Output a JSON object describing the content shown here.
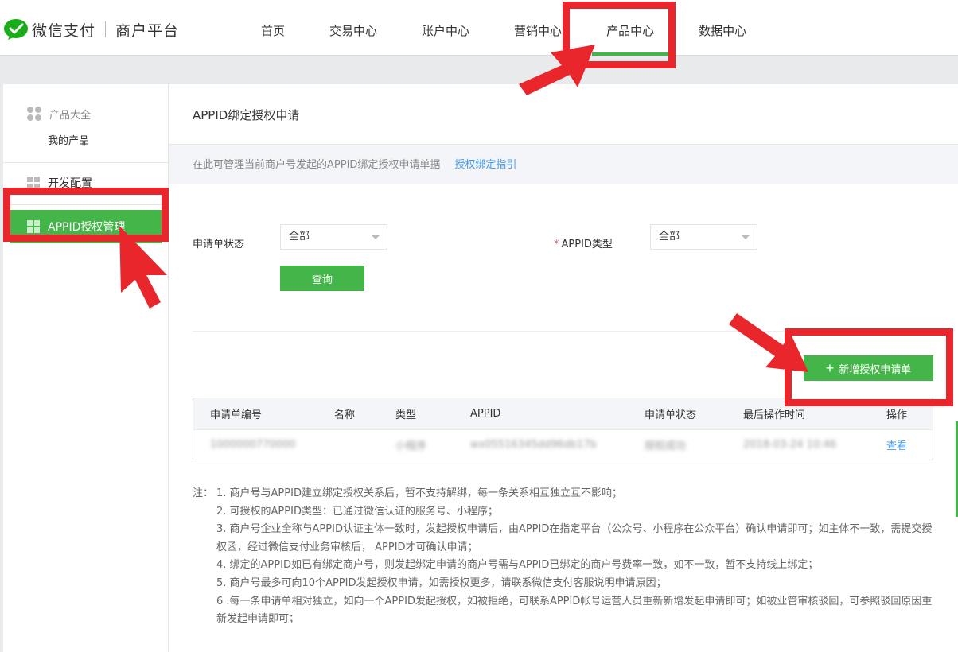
{
  "header": {
    "brand": "微信支付",
    "platform": "商户平台",
    "nav": [
      {
        "label": "首页",
        "active": false
      },
      {
        "label": "交易中心",
        "active": false
      },
      {
        "label": "账户中心",
        "active": false
      },
      {
        "label": "营销中心",
        "active": false
      },
      {
        "label": "产品中心",
        "active": true
      },
      {
        "label": "数据中心",
        "active": false
      }
    ]
  },
  "sidebar": {
    "group_title": "产品大全",
    "group_item": "我的产品",
    "items": [
      {
        "label": "开发配置",
        "active": false
      },
      {
        "label": "APPID授权管理",
        "active": true
      }
    ]
  },
  "main": {
    "title": "APPID绑定授权申请",
    "info_text": "在此可管理当前商户号发起的APPID绑定授权申请单据",
    "info_link": "授权绑定指引",
    "filter": {
      "status_label": "申请单状态",
      "status_value": "全部",
      "required_mark": "*",
      "type_label": "APPID类型",
      "type_value": "全部",
      "query_button": "查询"
    },
    "add_button_icon": "+",
    "add_button": "新增授权申请单",
    "table": {
      "columns": [
        "申请单编号",
        "名称",
        "类型",
        "APPID",
        "申请单状态",
        "最后操作时间",
        "操作"
      ],
      "rows": [
        {
          "id": "1000000770000",
          "name": "",
          "type": "小程序",
          "appid": "wx05516345dd96db17b",
          "status": "授权成功",
          "time": "2018-03-24 10:46",
          "action": "查看"
        }
      ]
    },
    "notes": {
      "prefix": "注：",
      "lines": [
        "1. 商户号与APPID建立绑定授权关系后，暂不支持解绑，每一条关系相互独立互不影响；",
        "2. 可授权的APPID类型：已通过微信认证的服务号、小程序；",
        "3. 商户号企业全称与APPID认证主体一致时，发起授权申请后，由APPID在指定平台（公众号、小程序在公众平台）确认申请即可；如主体不一致，需提交授权函，经过微信支付业务审核后， APPID才可确认申请；",
        "4. 绑定的APPID如已有绑定商户号，则发起绑定申请的商户号需与APPID已绑定的商户号费率一致，如不一致，暂不支持线上绑定；",
        "5. 商户号最多可向10个APPID发起授权申请，如需授权更多，请联系微信支付客服说明申请原因；",
        "6 .每一条申请单相对独立，如向一个APPID发起授权，如被拒绝，可联系APPID帐号运营人员重新新增发起申请即可；如被业管审核驳回，可参照驳回原因重新发起申请即可；"
      ]
    }
  },
  "colors": {
    "brand_green": "#44b549",
    "link_blue": "#459ae9",
    "annotation_red": "#e8262b"
  }
}
